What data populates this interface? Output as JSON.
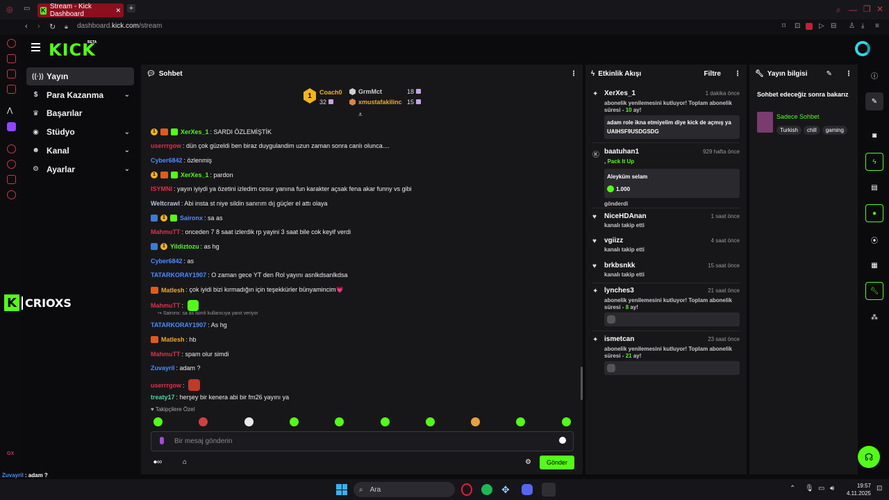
{
  "browser": {
    "tab_title": "Stream - Kick Dashboard",
    "url_prefix": "dashboard.",
    "url_domain": "kick.com",
    "url_path": "/stream"
  },
  "header": {
    "logo": "KICK",
    "beta": "BETA"
  },
  "nav": [
    {
      "label": "Yayın",
      "icon": "broadcast-icon",
      "glyph": "((·))",
      "active": true,
      "chevron": false
    },
    {
      "label": "Para Kazanma",
      "icon": "dollar-icon",
      "glyph": "$",
      "active": false,
      "chevron": true
    },
    {
      "label": "Başarılar",
      "icon": "trophy-icon",
      "glyph": "♛",
      "active": false,
      "chevron": false
    },
    {
      "label": "Stüdyo",
      "icon": "studio-icon",
      "glyph": "◉",
      "active": false,
      "chevron": true
    },
    {
      "label": "Kanal",
      "icon": "users-icon",
      "glyph": "☻",
      "active": false,
      "chevron": true
    },
    {
      "label": "Ayarlar",
      "icon": "gear-icon",
      "glyph": "⚙",
      "active": false,
      "chevron": true
    }
  ],
  "overlay_name": "CRIOXS",
  "chat": {
    "title": "Sohbet",
    "top_gifters": [
      {
        "rank": "1",
        "name": "Coach0",
        "count": "32"
      },
      {
        "rank": "",
        "name": "GrmMct",
        "count": "18"
      },
      {
        "rank": "",
        "name": "xmustafakilinc",
        "count": "15"
      }
    ],
    "messages": [
      {
        "badges": [
          "gold",
          "orange",
          "green"
        ],
        "user": "XerXes_1",
        "color": "#53fc18",
        "text": ": SARDI ÖZLEMİŞTİK"
      },
      {
        "badges": [],
        "user": "userrrgow",
        "color": "#e02f4a",
        "text": ": dün çok güzeldi ben biraz duygulandim uzun zaman sonra canlı olunca...."
      },
      {
        "badges": [],
        "user": "Cyber6842",
        "color": "#4b8cff",
        "text": ": özlenmiş"
      },
      {
        "badges": [
          "gold",
          "orange",
          "green"
        ],
        "user": "XerXes_1",
        "color": "#53fc18",
        "text": ": pardon"
      },
      {
        "badges": [],
        "user": "ISYMNI",
        "color": "#e02f4a",
        "text": ": yayın iyiydi ya özetini izledim cesur yanına fun karakter açsak fena akar funny vs gibi"
      },
      {
        "badges": [],
        "user": "Weltcrawl",
        "color": "#b8c4d6",
        "text": ": Abi insta st niye sildin sanırım dıj güçler el attı olaya"
      },
      {
        "badges": [
          "blue",
          "gold",
          "green"
        ],
        "user": "Saironx",
        "color": "#4b8cff",
        "text": ": sa as"
      },
      {
        "badges": [],
        "user": "MahmuTT",
        "color": "#e02f4a",
        "text": ": onceden 7 8 saat izlerdik rp yayini 3 saat bile cok keyif verdi"
      },
      {
        "badges": [
          "blue",
          "gold"
        ],
        "user": "Yildiztozu",
        "color": "#53fc18",
        "text": ": as hg"
      },
      {
        "badges": [],
        "user": "Cyber6842",
        "color": "#4b8cff",
        "text": ": as"
      },
      {
        "badges": [],
        "user": "TATARKORAY1907",
        "color": "#4b8cff",
        "text": ": O zaman gece YT den Rol yayını asnlkdsanlkdsa"
      },
      {
        "badges": [
          "orange"
        ],
        "user": "Matlesh",
        "color": "#f0a830",
        "text": ": çok iyidi bizi kırmadığın için teşekkürler bünyamincim💗"
      },
      {
        "badges": [],
        "user": "MahmuTT",
        "color": "#e02f4a",
        "text": ":"
      },
      {
        "badges": [],
        "user": "TATARKORAY1907",
        "color": "#4b8cff",
        "text": ": As hg"
      },
      {
        "badges": [
          "orange"
        ],
        "user": "Matlesh",
        "color": "#f0a830",
        "text": ": hb"
      },
      {
        "badges": [],
        "user": "MahmuTT",
        "color": "#e02f4a",
        "text": ": spam olur simdi"
      },
      {
        "badges": [],
        "user": "Zuvayril",
        "color": "#4b8cff",
        "text": ": adam ?"
      },
      {
        "badges": [],
        "user": "userrrgow",
        "color": "#e02f4a",
        "text": ":"
      },
      {
        "badges": [],
        "user": "treaty17",
        "color": "#53d1a0",
        "text": ": herşey bir kenera abi bir fm26 yayını ya"
      }
    ],
    "reply_hint": "Saironx: sa as isimli kullanıcıya yanıt veriyor",
    "followers_only": "Takipçilere Özel",
    "input_placeholder": "Bir mesaj gönderin",
    "send_label": "Gönder"
  },
  "events": {
    "title": "Etkinlik Akışı",
    "filter_label": "Filtre",
    "items": [
      {
        "icon": "star-icon",
        "name": "XerXes_1",
        "time": "1 dakika önce",
        "text": "abonelik yenilemesini kutluyor! Toplam abonelik süresi - ",
        "months": "10",
        "unit": " ay!",
        "box": "adam role ikna etmiyelim diye kick de açmış ya UAIHSF9USDGSDG"
      },
      {
        "icon": "kick-icon",
        "name": "baatuhan1",
        "time": "929 hafta önce",
        "text": ", ",
        "pack": "Pack It Up",
        "box": "Aleyküm selam",
        "amount": "1.000",
        "after": "gönderdi"
      },
      {
        "icon": "heart-icon",
        "name": "NiceHDAnan",
        "time": "1 saat önce",
        "text": "kanalı takip etti"
      },
      {
        "icon": "heart-icon",
        "name": "vgiizz",
        "time": "4 saat önce",
        "text": "kanalı takip etti"
      },
      {
        "icon": "heart-icon",
        "name": "brkbsnkk",
        "time": "15 saat önce",
        "text": "kanalı takip etti"
      },
      {
        "icon": "star-icon",
        "name": "lynches3",
        "time": "21 saat önce",
        "text": "abonelik yenilemesini kutluyor! Toplam abonelik süresi - ",
        "months": "8",
        "unit": " ay!"
      },
      {
        "icon": "star-icon",
        "name": "ismetcan",
        "time": "23 saat önce",
        "text": "abonelik yenilemesini kutluyor! Toplam abonelik süresi - ",
        "months": "21",
        "unit": " ay!"
      }
    ]
  },
  "info": {
    "title": "Yayın bilgisi",
    "stream_title": "Sohbet edeceğiz sonra bakarız",
    "category": "Sadece Sohbet",
    "tags": [
      "Turkish",
      "chill",
      "gaming"
    ]
  },
  "bottom_overlay": [
    {
      "user": "Zuvayril",
      "color": "#4b8cff",
      "text": " : adam ?"
    },
    {
      "user": "userrrgow",
      "color": "#e02f4a",
      "text": " : "
    },
    {
      "user": "treaty17",
      "color": "#53d1a0",
      "text": " : herşey bir kenera abi bir fm26 yayını ya"
    }
  ],
  "taskbar": {
    "search": "Ara",
    "time": "19:57",
    "date": "4.11.2025"
  }
}
